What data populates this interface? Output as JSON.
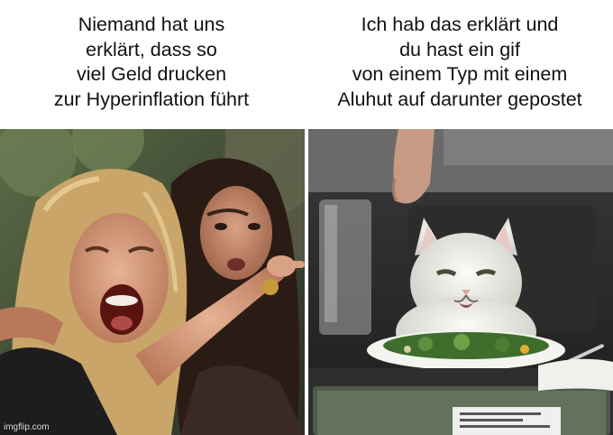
{
  "captions": {
    "left": "Niemand hat uns\nerklärt, dass so\nviel Geld drucken\nzur Hyperinflation führt",
    "right": "Ich hab das erklärt und\ndu hast ein gif\nvon einem Typ mit einem\nAluhut auf darunter gepostet"
  },
  "watermark": "imgflip.com",
  "colors": {
    "background": "#ffffff",
    "caption_text": "#111111",
    "left_scene": "#4c5a3c",
    "right_scene": "#2a2a2a",
    "cat": "#efefea"
  },
  "illustrations": {
    "left_panel": "woman-yelling-photo",
    "right_panel": "cat-at-dinner-table-photo"
  }
}
